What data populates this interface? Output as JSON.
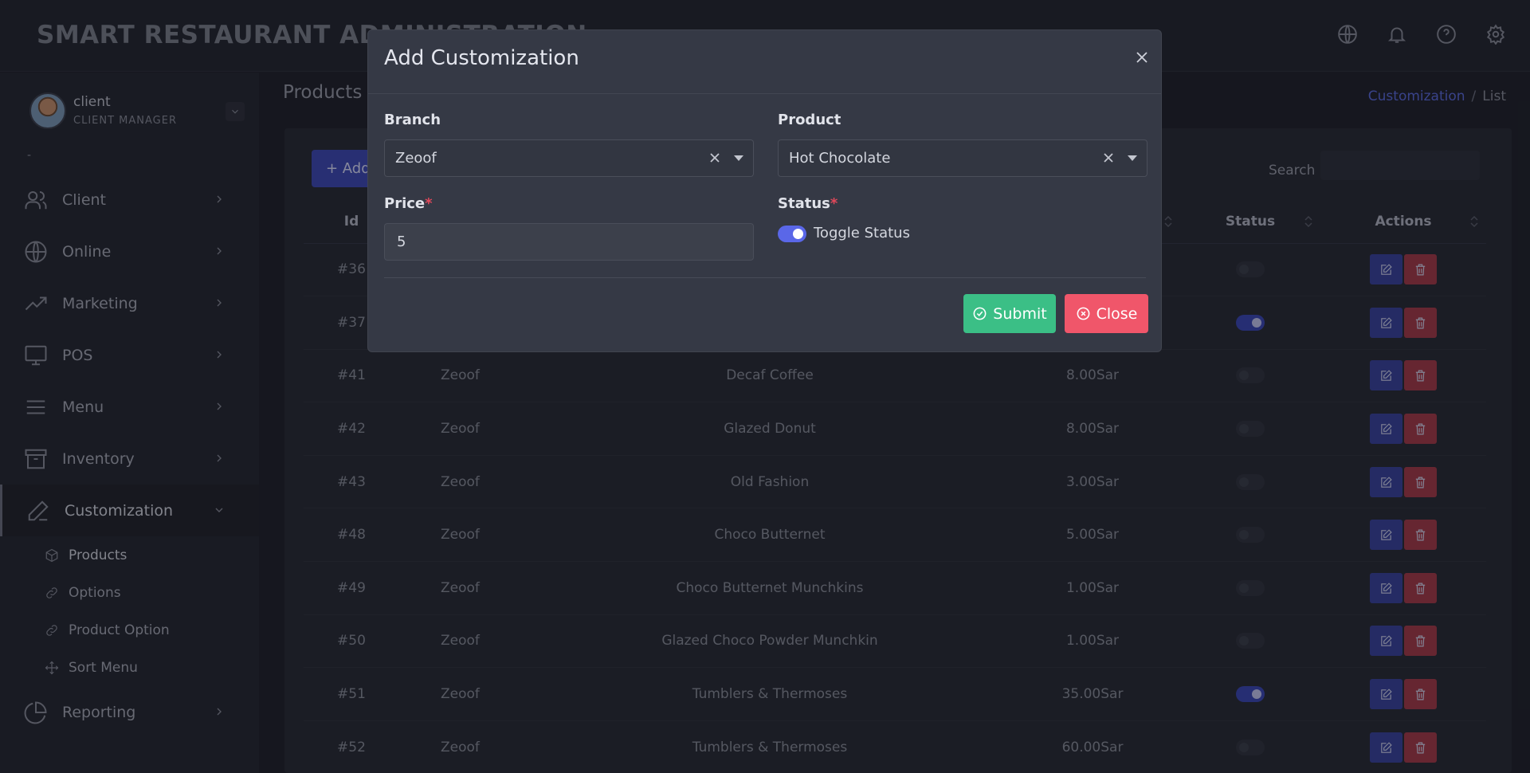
{
  "header": {
    "title": "SMART RESTAURANT ADMINISTRATION",
    "icons": [
      "globe-icon",
      "bell-icon",
      "help-icon",
      "settings-icon"
    ]
  },
  "user": {
    "name": "client",
    "role": "CLIENT MANAGER",
    "dash": "-"
  },
  "sidebar": {
    "items": [
      {
        "label": "Client",
        "icon": "users-icon"
      },
      {
        "label": "Online",
        "icon": "globe-icon"
      },
      {
        "label": "Marketing",
        "icon": "trending-up-icon"
      },
      {
        "label": "POS",
        "icon": "monitor-icon"
      },
      {
        "label": "Menu",
        "icon": "menu-icon"
      },
      {
        "label": "Inventory",
        "icon": "archive-icon"
      },
      {
        "label": "Customization",
        "icon": "pen-icon"
      },
      {
        "label": "Reporting",
        "icon": "pie-chart-icon"
      }
    ],
    "subitems": [
      {
        "label": "Products",
        "icon": "box-icon"
      },
      {
        "label": "Options",
        "icon": "link-icon"
      },
      {
        "label": "Product Option",
        "icon": "link-icon"
      },
      {
        "label": "Sort Menu",
        "icon": "move-icon"
      }
    ]
  },
  "page": {
    "title": "Products C",
    "breadcrumb": {
      "link": "Customization",
      "sep": "/",
      "current": "List"
    },
    "add_button": "+ Add",
    "search_label": "Search",
    "search_value": ""
  },
  "table": {
    "headers": {
      "id": "Id",
      "branch": "",
      "product": "",
      "price": "",
      "status": "Status",
      "actions": "Actions"
    },
    "rows": [
      {
        "id": "#36",
        "branch": "",
        "product": "",
        "price": "",
        "status": false
      },
      {
        "id": "#37",
        "branch": "",
        "product": "",
        "price": "",
        "status": true
      },
      {
        "id": "#41",
        "branch": "Zeoof",
        "product": "Decaf Coffee",
        "price": "8.00Sar",
        "status": false
      },
      {
        "id": "#42",
        "branch": "Zeoof",
        "product": "Glazed Donut",
        "price": "8.00Sar",
        "status": false
      },
      {
        "id": "#43",
        "branch": "Zeoof",
        "product": "Old Fashion",
        "price": "3.00Sar",
        "status": false
      },
      {
        "id": "#48",
        "branch": "Zeoof",
        "product": "Choco Butternet",
        "price": "5.00Sar",
        "status": false
      },
      {
        "id": "#49",
        "branch": "Zeoof",
        "product": "Choco Butternet Munchkins",
        "price": "1.00Sar",
        "status": false
      },
      {
        "id": "#50",
        "branch": "Zeoof",
        "product": "Glazed Choco Powder Munchkin",
        "price": "1.00Sar",
        "status": false
      },
      {
        "id": "#51",
        "branch": "Zeoof",
        "product": "Tumblers & Thermoses",
        "price": "35.00Sar",
        "status": true
      },
      {
        "id": "#52",
        "branch": "Zeoof",
        "product": "Tumblers & Thermoses",
        "price": "60.00Sar",
        "status": false
      }
    ]
  },
  "modal": {
    "title": "Add Customization",
    "branch_label": "Branch",
    "branch_value": "Zeoof",
    "product_label": "Product",
    "product_value": "Hot Chocolate",
    "price_label": "Price",
    "price_value": "5",
    "status_label": "Status",
    "required_mark": "*",
    "toggle_label": "Toggle Status",
    "toggle_on": true,
    "submit_label": "Submit",
    "close_label": "Close"
  },
  "colors": {
    "accent": "#5a67e8",
    "submit": "#3bbf86",
    "close": "#f0566a",
    "breadcrumb_link": "#5b6be0"
  }
}
